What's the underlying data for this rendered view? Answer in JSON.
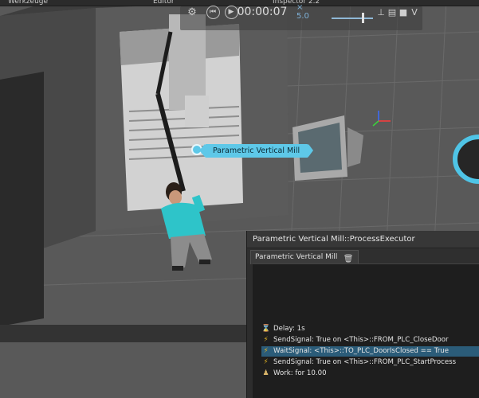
{
  "menubar": {
    "left": "Werkzeuge",
    "middle": "Editor",
    "right": "Inspector 2.2"
  },
  "toolbar": {
    "time": "00:00:07",
    "speed": "× 5.0"
  },
  "component_label": "Parametric Vertical Mill",
  "panel": {
    "title": "Parametric Vertical Mill::ProcessExecutor",
    "tab": "Parametric Vertical Mill",
    "statements": [
      {
        "icon": "hourglass-icon",
        "glyph": "⌛",
        "text": "Delay: 1s"
      },
      {
        "icon": "signal-bolt-icon",
        "glyph": "⚡",
        "text": "SendSignal: True on <This>::FROM_PLC_CloseDoor"
      },
      {
        "icon": "wait-signal-icon",
        "glyph": "⚡",
        "text": "WaitSignal: <This>::TO_PLC_DoorIsClosed == True"
      },
      {
        "icon": "signal-bolt-icon",
        "glyph": "⚡",
        "text": "SendSignal: True on <This>::FROM_PLC_StartProcess"
      },
      {
        "icon": "work-icon",
        "glyph": "♟",
        "text": "Work: for 10.00"
      }
    ]
  },
  "colors": {
    "accent": "#5ec8e8",
    "selection": "#2b5c79",
    "signal": "#e6b422"
  }
}
